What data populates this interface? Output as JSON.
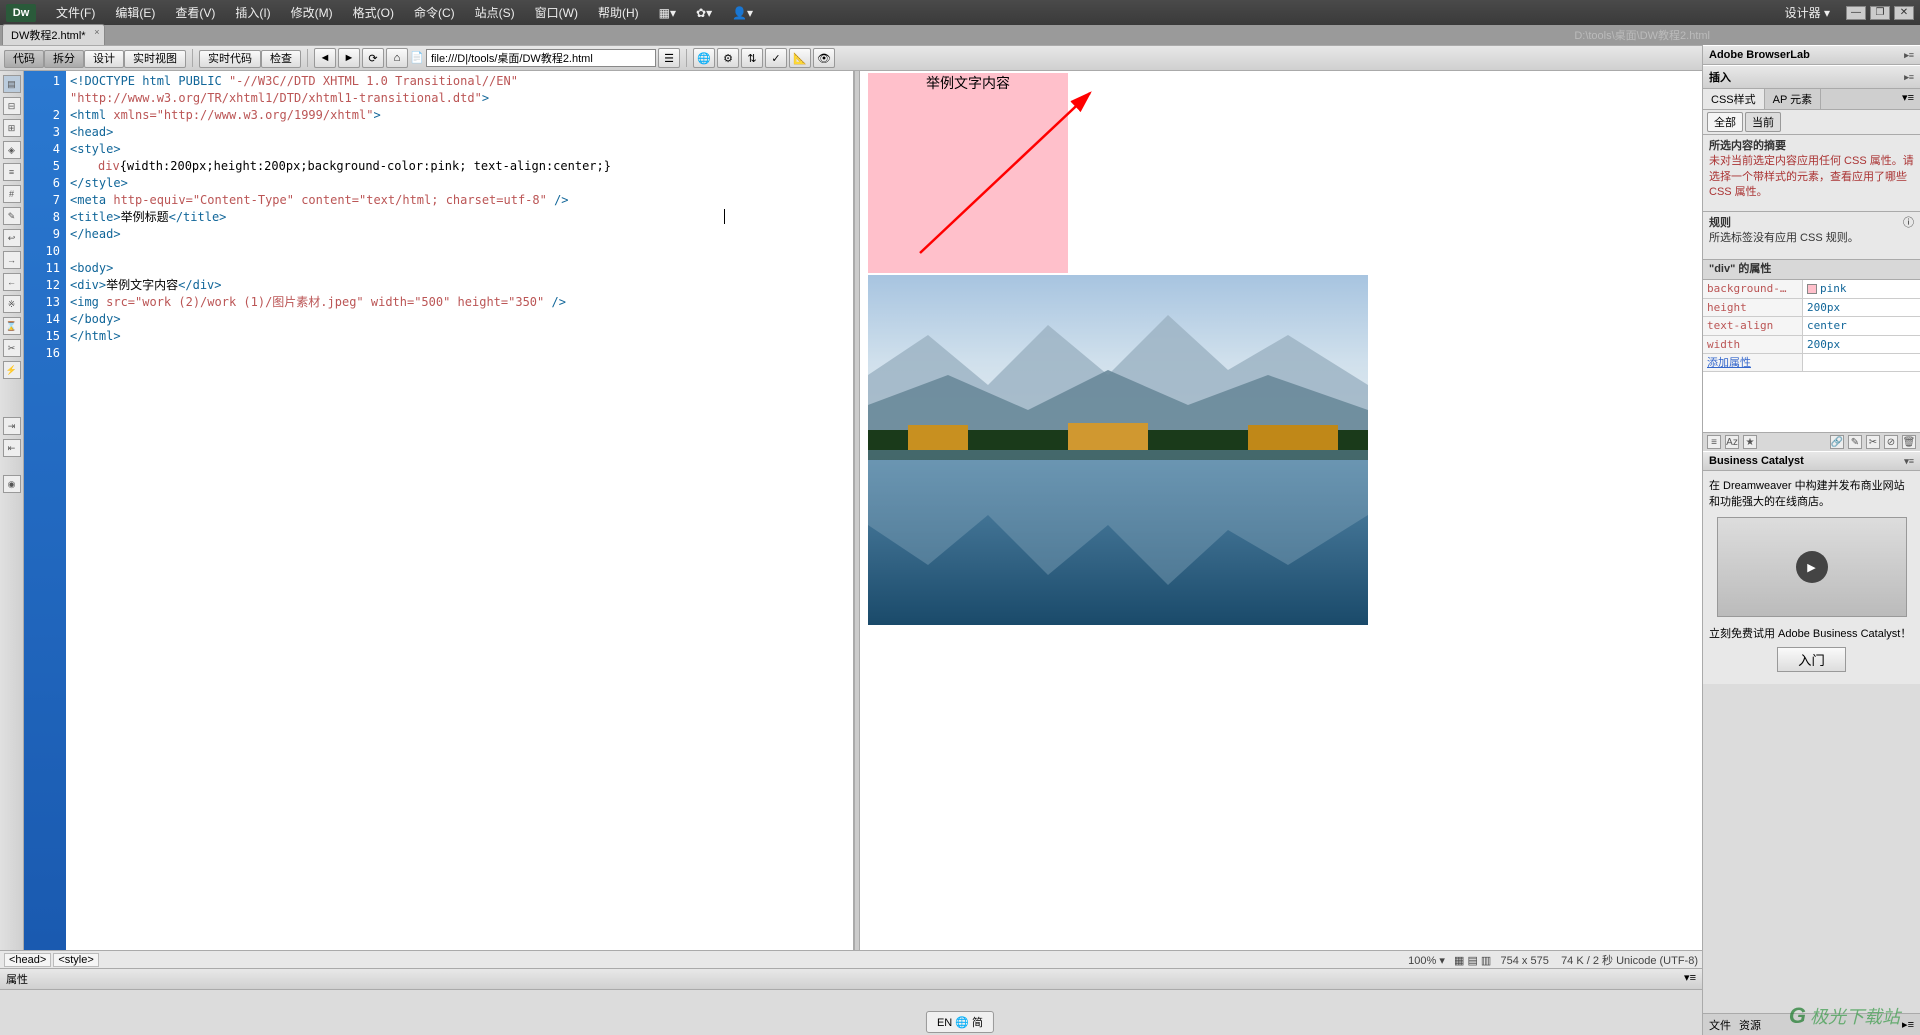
{
  "app": {
    "logo": "Dw"
  },
  "menus": [
    "文件(F)",
    "编辑(E)",
    "查看(V)",
    "插入(I)",
    "修改(M)",
    "格式(O)",
    "命令(C)",
    "站点(S)",
    "窗口(W)",
    "帮助(H)"
  ],
  "menu_right": {
    "designer": "设计器",
    "min": "—",
    "max": "❐",
    "close": "✕"
  },
  "doc_tab": {
    "label": "DW教程2.html*",
    "close": "×"
  },
  "doc_path": "D:\\tools\\桌面\\DW教程2.html",
  "toolbar": {
    "view_buttons": [
      "代码",
      "拆分",
      "设计",
      "实时视图"
    ],
    "code_buttons": [
      "实时代码",
      "检查"
    ],
    "addr_value": "file:///D|/tools/桌面/DW教程2.html"
  },
  "code": {
    "lines": [
      {
        "n": "1",
        "html": "<span class='tag'>&lt;!DOCTYPE html PUBLIC </span><span class='attr'>\"-//W3C//DTD XHTML 1.0 Transitional//EN\"</span>"
      },
      {
        "n": "",
        "html": "<span class='attr'>\"http://www.w3.org/TR/xhtml1/DTD/xhtml1-transitional.dtd\"</span><span class='tag'>&gt;</span>"
      },
      {
        "n": "2",
        "html": "<span class='tag'>&lt;html </span><span class='attr'>xmlns=\"http://www.w3.org/1999/xhtml\"</span><span class='tag'>&gt;</span>"
      },
      {
        "n": "3",
        "html": "<span class='tag'>&lt;head&gt;</span>"
      },
      {
        "n": "4",
        "html": "<span class='tag'>&lt;style&gt;</span>"
      },
      {
        "n": "5",
        "html": "<span class='ind1'><span class='attr'>div</span><span class='txt'>{width:200px;height:200px;background-color:pink; text-align:center;}</span></span>"
      },
      {
        "n": "6",
        "html": "<span class='tag'>&lt;/style&gt;</span>"
      },
      {
        "n": "7",
        "html": "<span class='tag'>&lt;meta </span><span class='attr'>http-equiv=\"Content-Type\" content=\"text/html; charset=utf-8\"</span><span class='tag'> /&gt;</span>"
      },
      {
        "n": "8",
        "html": "<span class='tag'>&lt;title&gt;</span><span class='txt'>举例标题</span><span class='tag'>&lt;/title&gt;</span>"
      },
      {
        "n": "9",
        "html": "<span class='tag'>&lt;/head&gt;</span>"
      },
      {
        "n": "10",
        "html": ""
      },
      {
        "n": "11",
        "html": "<span class='tag'>&lt;body&gt;</span>"
      },
      {
        "n": "12",
        "html": "<span class='tag'>&lt;div&gt;</span><span class='txt'>举例文字内容</span><span class='tag'>&lt;/div&gt;</span>"
      },
      {
        "n": "13",
        "html": "<span class='tag'>&lt;img </span><span class='attr'>src=\"work (2)/work (1)/图片素材.jpeg\" width=\"500\" height=\"350\"</span><span class='tag'> /&gt;</span>"
      },
      {
        "n": "14",
        "html": "<span class='tag'>&lt;/body&gt;</span>"
      },
      {
        "n": "15",
        "html": "<span class='tag'>&lt;/html&gt;</span>"
      },
      {
        "n": "16",
        "html": ""
      }
    ]
  },
  "preview": {
    "box_text": "举例文字内容"
  },
  "tag_selector": {
    "tags": [
      "<head>",
      "<style>"
    ],
    "zoom": "100%",
    "dims": "754 x 575",
    "size": "74 K / 2 秒 Unicode (UTF-8)"
  },
  "right": {
    "browserlab": "Adobe BrowserLab",
    "insert": "插入",
    "css_tab": "CSS样式",
    "ap_tab": "AP 元素",
    "sub_all": "全部",
    "sub_cur": "当前",
    "summary_title": "所选内容的摘要",
    "summary_body": "未对当前选定内容应用任何 CSS 属性。请选择一个带样式的元素，查看应用了哪些 CSS 属性。",
    "rules_title": "规则",
    "rules_body": "所选标签没有应用 CSS 规则。",
    "props_title": "\"div\" 的属性",
    "rows": [
      {
        "k": "background-…",
        "v": "pink",
        "swatch": true
      },
      {
        "k": "height",
        "v": "200px"
      },
      {
        "k": "text-align",
        "v": "center"
      },
      {
        "k": "width",
        "v": "200px"
      }
    ],
    "add_prop": "添加属性",
    "bc_title": "Business Catalyst",
    "bc_text": "在 Dreamweaver 中构建并发布商业网站和功能强大的在线商店。",
    "bc_cta": "立刻免费试用 Adobe Business Catalyst！",
    "bc_btn": "入门",
    "footer_files": "文件",
    "footer_assets": "资源"
  },
  "properties_panel": "属性",
  "ime": "EN 🌐 简",
  "watermark": "极光下载站"
}
